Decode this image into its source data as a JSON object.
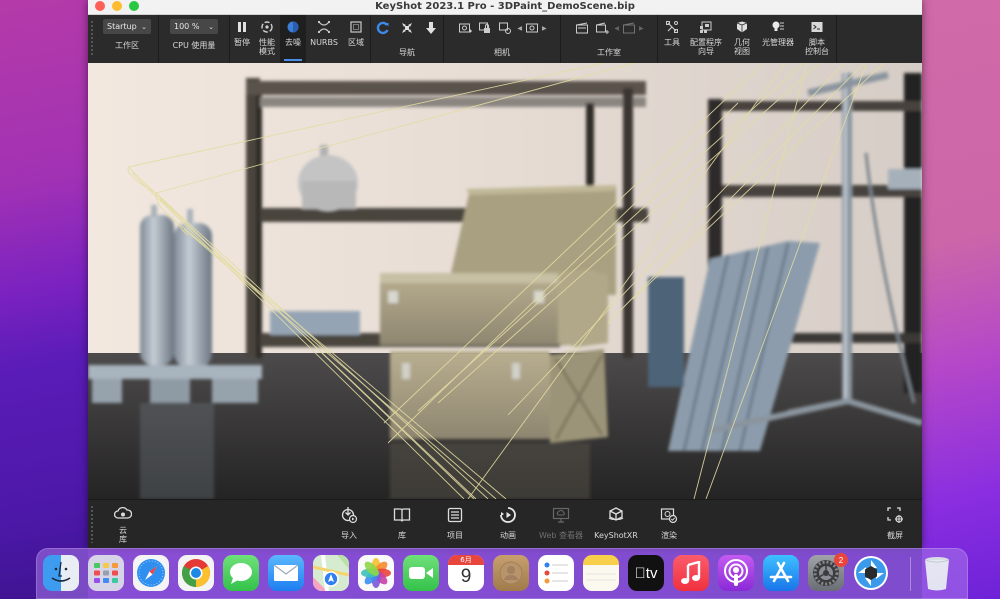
{
  "window": {
    "title": "KeyShot 2023.1 Pro  - 3DPaint_DemoScene.bip"
  },
  "ribbon": {
    "workspace": {
      "selected": "Startup",
      "label": "工作区"
    },
    "cpu": {
      "selected": "100 %",
      "label": "CPU 使用量"
    },
    "tools": [
      {
        "id": "pause",
        "label": "暂停",
        "icon": "pause-icon"
      },
      {
        "id": "performance",
        "label": "性能\n模式",
        "label_line1": "性能",
        "label_line2": "模式",
        "icon": "performance-mode-icon"
      },
      {
        "id": "denoise",
        "label": "去噪",
        "icon": "denoise-icon",
        "active": true
      },
      {
        "id": "nurbs",
        "label": "NURBS",
        "icon": "nurbs-icon"
      },
      {
        "id": "region",
        "label": "区域",
        "icon": "region-icon"
      }
    ],
    "navigation": {
      "label": "导航"
    },
    "camera": {
      "label": "相机"
    },
    "studio": {
      "label": "工作室"
    },
    "right_tools": [
      {
        "id": "tools",
        "label": "工具",
        "label_line1": "工具",
        "label_line2": ""
      },
      {
        "id": "config-wizard",
        "label_line1": "配置程序",
        "label_line2": "向导"
      },
      {
        "id": "geometry-view",
        "label_line1": "几何",
        "label_line2": "视图"
      },
      {
        "id": "light-manager",
        "label_line1": "光管理器",
        "label_line2": ""
      },
      {
        "id": "script-console",
        "label_line1": "脚本",
        "label_line2": "控制台"
      }
    ],
    "accent_color": "#4a8ee8"
  },
  "bottombar": {
    "cloud_library": {
      "line1": "云",
      "line2": "库"
    },
    "items": [
      {
        "id": "import",
        "label": "导入"
      },
      {
        "id": "library",
        "label": "库"
      },
      {
        "id": "project",
        "label": "项目"
      },
      {
        "id": "animation",
        "label": "动画"
      },
      {
        "id": "web-viewer",
        "label": "Web 查看器",
        "disabled": true
      },
      {
        "id": "keyshotxr",
        "label": "KeyShotXR"
      },
      {
        "id": "render",
        "label": "渲染"
      }
    ],
    "screenshot": {
      "label": "截屏"
    }
  },
  "dock": {
    "apps": [
      {
        "id": "finder",
        "name": "Finder"
      },
      {
        "id": "launchpad",
        "name": "Launchpad"
      },
      {
        "id": "safari",
        "name": "Safari"
      },
      {
        "id": "chrome",
        "name": "Google Chrome"
      },
      {
        "id": "messages",
        "name": "Messages"
      },
      {
        "id": "mail",
        "name": "Mail"
      },
      {
        "id": "maps",
        "name": "Maps"
      },
      {
        "id": "photos",
        "name": "Photos"
      },
      {
        "id": "facetime",
        "name": "FaceTime"
      },
      {
        "id": "calendar",
        "name": "Calendar",
        "month": "6月",
        "day": "9"
      },
      {
        "id": "contacts",
        "name": "Contacts"
      },
      {
        "id": "reminders",
        "name": "Reminders"
      },
      {
        "id": "notes",
        "name": "Notes"
      },
      {
        "id": "tv",
        "name": "TV",
        "text": "tv"
      },
      {
        "id": "music",
        "name": "Music"
      },
      {
        "id": "podcasts",
        "name": "Podcasts"
      },
      {
        "id": "appstore",
        "name": "App Store"
      },
      {
        "id": "settings",
        "name": "System Preferences",
        "badge": "2"
      },
      {
        "id": "keyshot",
        "name": "KeyShot"
      },
      {
        "id": "trash",
        "name": "Trash"
      }
    ]
  }
}
